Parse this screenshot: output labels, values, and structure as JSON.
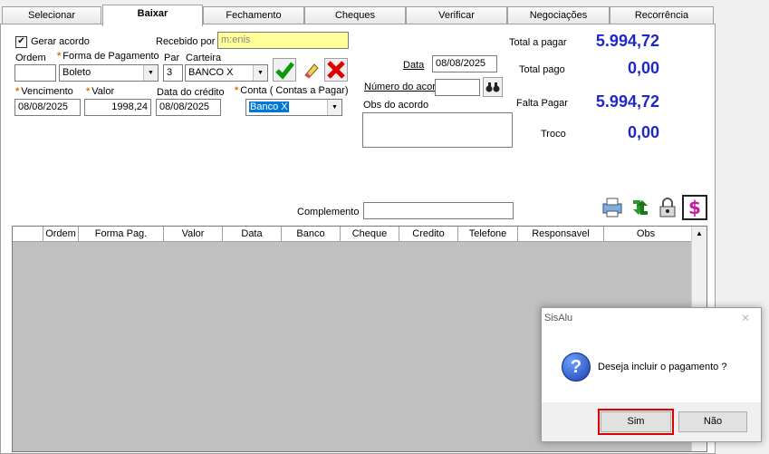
{
  "tabs": [
    "Selecionar",
    "Baixar",
    "Fechamento",
    "Cheques",
    "Verificar",
    "Negociações",
    "Recorrência"
  ],
  "form": {
    "gerar_acordo_label": "Gerar acordo",
    "gerar_acordo_checked": true,
    "recebido_por_label": "Recebido por",
    "recebido_por_value": "m:enis",
    "ordem_label": "Ordem",
    "ordem_value": "",
    "forma_label": "Forma de Pagamento",
    "forma_value": "Boleto",
    "par_label": "Par",
    "par_value": "3",
    "carteira_label": "Carteira",
    "carteira_value": "BANCO X",
    "vencimento_label": "Vencimento",
    "vencimento_value": "08/08/2025",
    "valor_label": "Valor",
    "valor_value": "1998,24",
    "data_credito_label": "Data do crédito",
    "data_credito_value": "08/08/2025",
    "conta_label": "Conta ( Contas a Pagar)",
    "conta_value": "Banco X",
    "data_label": "Data",
    "data_value": "08/08/2025",
    "numero_acordo_label": "Número do acor",
    "numero_acordo_value": "",
    "obs_acordo_label": "Obs do acordo",
    "complemento_label": "Complemento",
    "required_mark": "*"
  },
  "totals": {
    "total_pagar_label": "Total a pagar",
    "total_pagar_value": "5.994,72",
    "total_pago_label": "Total pago",
    "total_pago_value": "0,00",
    "falta_pagar_label": "Falta Pagar",
    "falta_pagar_value": "5.994,72",
    "troco_label": "Troco",
    "troco_value": "0,00"
  },
  "grid_headers": [
    "Ordem",
    "Forma Pag.",
    "Valor",
    "Data",
    "Banco",
    "Cheque",
    "Credito",
    "Telefone",
    "Responsavel",
    "Obs"
  ],
  "dialog": {
    "title": "SisAlu",
    "close": "✕",
    "message": "Deseja incluir o pagamento ?",
    "yes": "Sim",
    "no": "Não"
  },
  "colors": {
    "accent_blue": "#1e28c8",
    "highlight": "#ffff99",
    "focus_red": "#e00000"
  }
}
